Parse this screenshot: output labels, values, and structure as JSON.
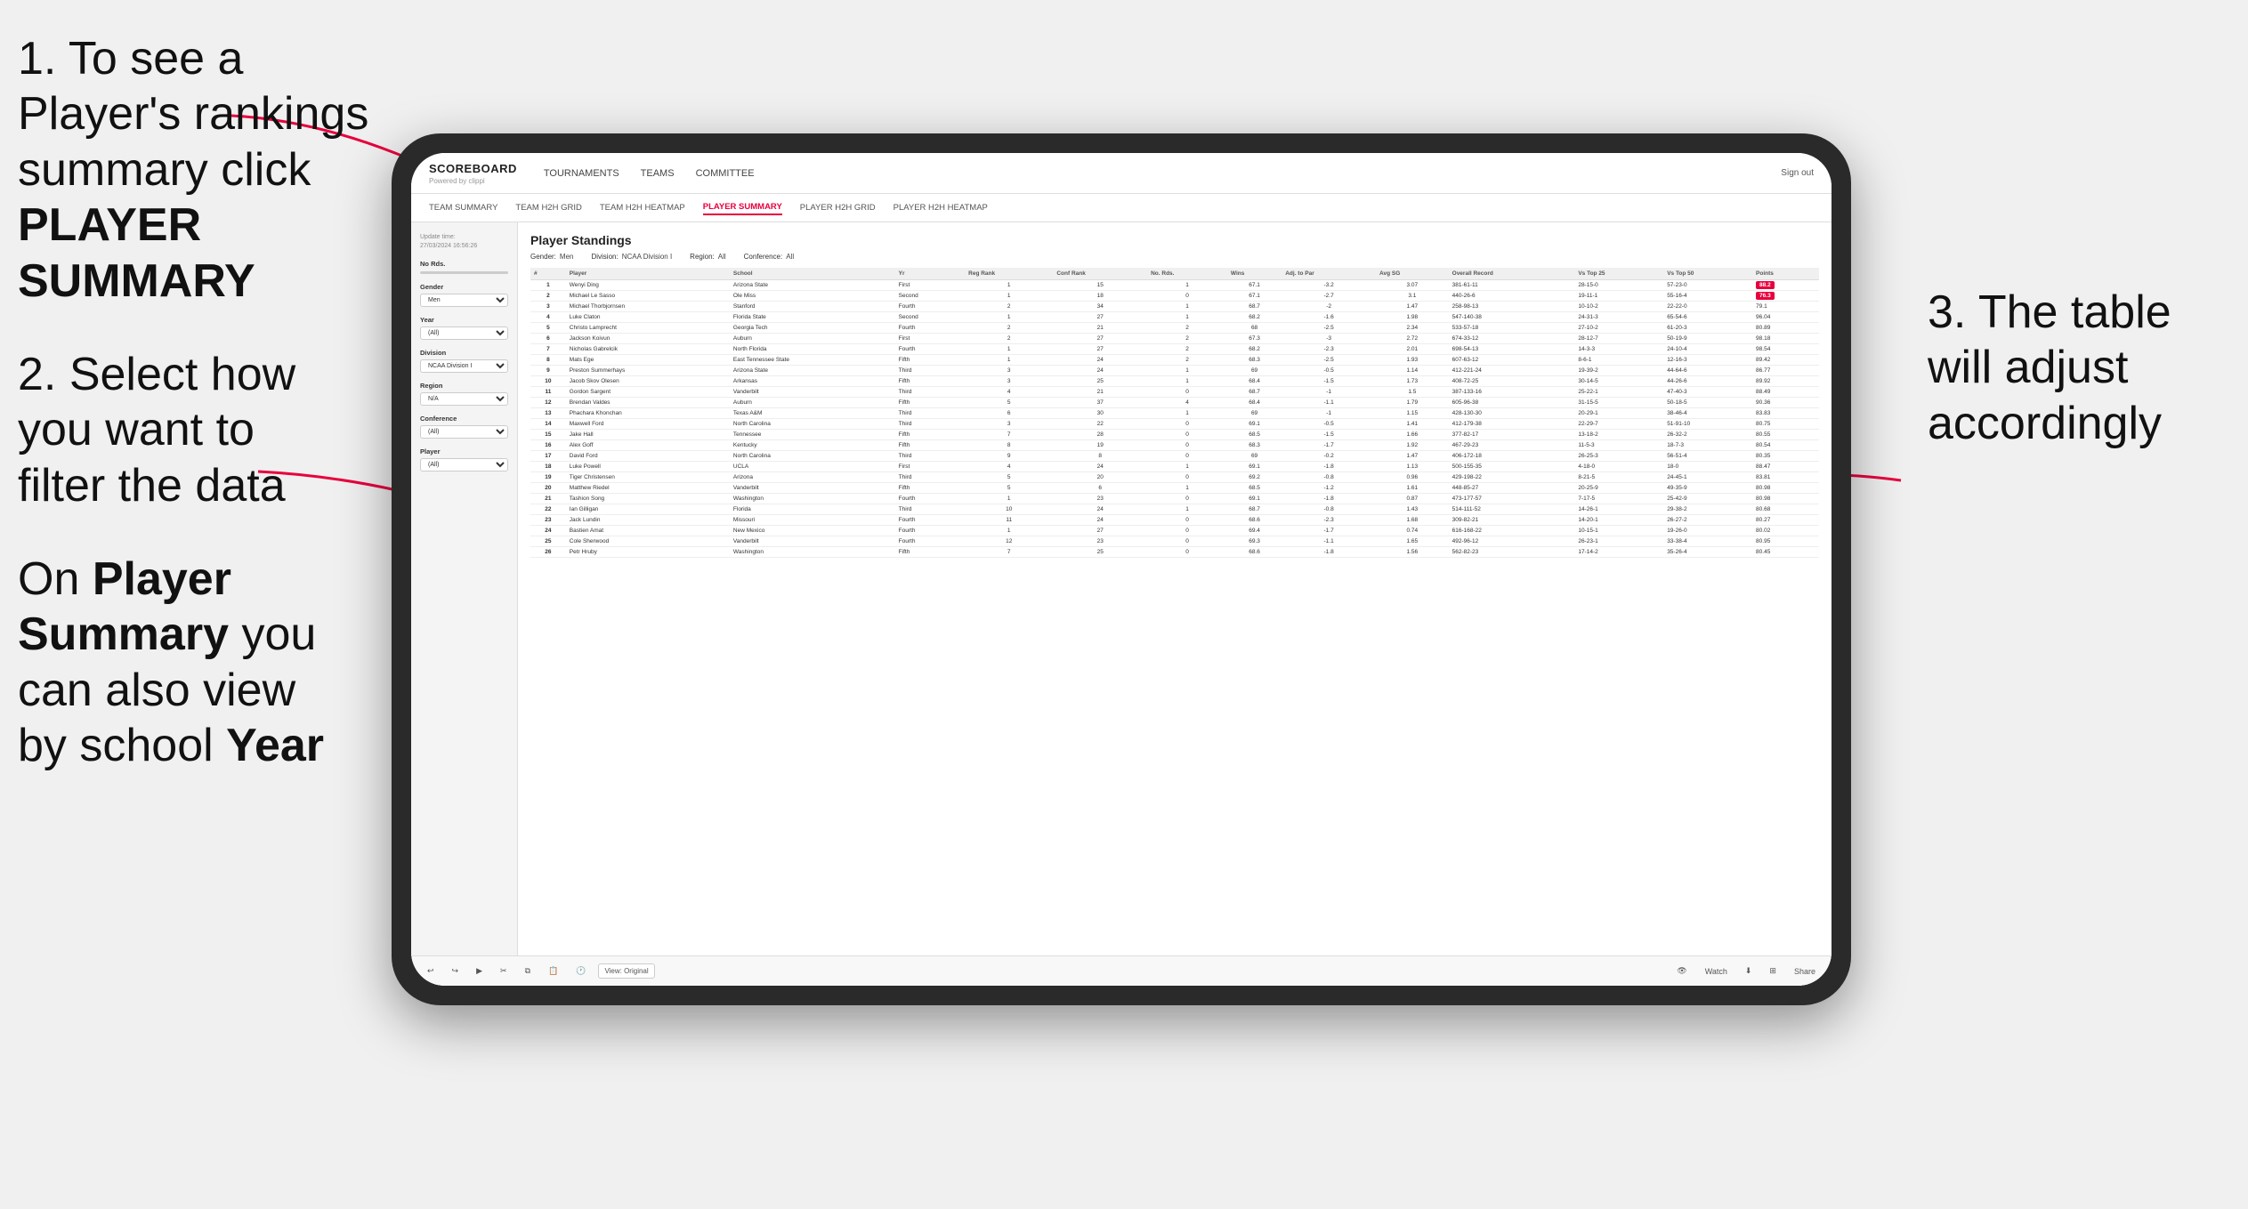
{
  "instructions": {
    "step1_text": "1. To see a Player's rankings summary click ",
    "step1_bold": "PLAYER SUMMARY",
    "step2_text": "2. Select how you want to filter the data",
    "step_bottom_text": "On ",
    "step_bottom_bold1": "Player Summary",
    "step_bottom_rest": " you can also view by school ",
    "step_bottom_bold2": "Year",
    "step3_text": "3. The table will adjust accordingly"
  },
  "app": {
    "logo": "SCOREBOARD",
    "logo_sub": "Powered by clippi",
    "sign_out": "Sign out"
  },
  "nav": {
    "items": [
      {
        "label": "TOURNAMENTS",
        "active": false
      },
      {
        "label": "TEAMS",
        "active": false
      },
      {
        "label": "COMMITTEE",
        "active": false
      }
    ]
  },
  "subnav": {
    "items": [
      {
        "label": "TEAM SUMMARY",
        "active": false
      },
      {
        "label": "TEAM H2H GRID",
        "active": false
      },
      {
        "label": "TEAM H2H HEATMAP",
        "active": false
      },
      {
        "label": "PLAYER SUMMARY",
        "active": true
      },
      {
        "label": "PLAYER H2H GRID",
        "active": false
      },
      {
        "label": "PLAYER H2H HEATMAP",
        "active": false
      }
    ]
  },
  "sidebar": {
    "update_label": "Update time:",
    "update_time": "27/03/2024 16:56:26",
    "no_rds_label": "No Rds.",
    "gender_label": "Gender",
    "gender_value": "Men",
    "year_label": "Year",
    "year_value": "(All)",
    "division_label": "Division",
    "division_value": "NCAA Division I",
    "region_label": "Region",
    "region_value": "N/A",
    "conference_label": "Conference",
    "conference_value": "(All)",
    "player_label": "Player",
    "player_value": "(All)"
  },
  "table": {
    "title": "Player Standings",
    "gender": "Men",
    "division": "NCAA Division I",
    "region": "All",
    "conference": "All",
    "columns": [
      "#",
      "Player",
      "School",
      "Yr",
      "Reg Rank",
      "Conf Rank",
      "No. Rds.",
      "Wins",
      "Adj. to Par",
      "Avg SG",
      "Overall Record",
      "Vs Top 25",
      "Vs Top 50",
      "Points"
    ],
    "rows": [
      {
        "rank": 1,
        "player": "Wenyi Ding",
        "school": "Arizona State",
        "yr": "First",
        "reg_rank": 1,
        "conf_rank": 15,
        "rds": 1,
        "wins": 67.1,
        "adj": -3.2,
        "sg": 3.07,
        "record": "381-61-11",
        "vst25": "28-15-0",
        "vst50": "57-23-0",
        "points": "88.2",
        "highlight": true
      },
      {
        "rank": 2,
        "player": "Michael Le Sasso",
        "school": "Ole Miss",
        "yr": "Second",
        "reg_rank": 1,
        "conf_rank": 18,
        "rds": 0,
        "wins": 67.1,
        "adj": -2.7,
        "sg": 3.1,
        "record": "440-26-6",
        "vst25": "19-11-1",
        "vst50": "55-16-4",
        "points": "76.3",
        "highlight": true
      },
      {
        "rank": 3,
        "player": "Michael Thorbjornsen",
        "school": "Stanford",
        "yr": "Fourth",
        "reg_rank": 2,
        "conf_rank": 34,
        "rds": 1,
        "wins": 68.7,
        "adj": -2.0,
        "sg": 1.47,
        "record": "258-98-13",
        "vst25": "10-10-2",
        "vst50": "22-22-0",
        "points": "79.1"
      },
      {
        "rank": 4,
        "player": "Luke Claton",
        "school": "Florida State",
        "yr": "Second",
        "reg_rank": 1,
        "conf_rank": 27,
        "rds": 1,
        "wins": 68.2,
        "adj": -1.6,
        "sg": 1.98,
        "record": "547-140-38",
        "vst25": "24-31-3",
        "vst50": "65-54-6",
        "points": "96.04"
      },
      {
        "rank": 5,
        "player": "Christo Lamprecht",
        "school": "Georgia Tech",
        "yr": "Fourth",
        "reg_rank": 2,
        "conf_rank": 21,
        "rds": 2,
        "wins": 68.0,
        "adj": -2.5,
        "sg": 2.34,
        "record": "533-57-18",
        "vst25": "27-10-2",
        "vst50": "61-20-3",
        "points": "80.89"
      },
      {
        "rank": 6,
        "player": "Jackson Koivun",
        "school": "Auburn",
        "yr": "First",
        "reg_rank": 2,
        "conf_rank": 27,
        "rds": 2,
        "wins": 67.3,
        "adj": -3.0,
        "sg": 2.72,
        "record": "674-33-12",
        "vst25": "28-12-7",
        "vst50": "50-19-9",
        "points": "98.18"
      },
      {
        "rank": 7,
        "player": "Nicholas Gabrelcik",
        "school": "North Florida",
        "yr": "Fourth",
        "reg_rank": 1,
        "conf_rank": 27,
        "rds": 2,
        "wins": 68.2,
        "adj": -2.3,
        "sg": 2.01,
        "record": "698-54-13",
        "vst25": "14-3-3",
        "vst50": "24-10-4",
        "points": "98.54"
      },
      {
        "rank": 8,
        "player": "Mats Ege",
        "school": "East Tennessee State",
        "yr": "Fifth",
        "reg_rank": 1,
        "conf_rank": 24,
        "rds": 2,
        "wins": 68.3,
        "adj": -2.5,
        "sg": 1.93,
        "record": "607-63-12",
        "vst25": "8-6-1",
        "vst50": "12-16-3",
        "points": "89.42"
      },
      {
        "rank": 9,
        "player": "Preston Summerhays",
        "school": "Arizona State",
        "yr": "Third",
        "reg_rank": 3,
        "conf_rank": 24,
        "rds": 1,
        "wins": 69.0,
        "adj": -0.5,
        "sg": 1.14,
        "record": "412-221-24",
        "vst25": "19-39-2",
        "vst50": "44-64-6",
        "points": "86.77"
      },
      {
        "rank": 10,
        "player": "Jacob Skov Olesen",
        "school": "Arkansas",
        "yr": "Fifth",
        "reg_rank": 3,
        "conf_rank": 25,
        "rds": 1,
        "wins": 68.4,
        "adj": -1.5,
        "sg": 1.73,
        "record": "408-72-25",
        "vst25": "30-14-5",
        "vst50": "44-26-6",
        "points": "89.92"
      },
      {
        "rank": 11,
        "player": "Gordon Sargent",
        "school": "Vanderbilt",
        "yr": "Third",
        "reg_rank": 4,
        "conf_rank": 21,
        "rds": 0,
        "wins": 68.7,
        "adj": -1.0,
        "sg": 1.5,
        "record": "387-133-16",
        "vst25": "25-22-1",
        "vst50": "47-40-3",
        "points": "88.49"
      },
      {
        "rank": 12,
        "player": "Brendan Valdes",
        "school": "Auburn",
        "yr": "Fifth",
        "reg_rank": 5,
        "conf_rank": 37,
        "rds": 4,
        "wins": 68.4,
        "adj": -1.1,
        "sg": 1.79,
        "record": "605-96-38",
        "vst25": "31-15-5",
        "vst50": "50-18-5",
        "points": "90.36"
      },
      {
        "rank": 13,
        "player": "Phachara Khonchan",
        "school": "Texas A&M",
        "yr": "Third",
        "reg_rank": 6,
        "conf_rank": 30,
        "rds": 1,
        "wins": 69.0,
        "adj": -1.0,
        "sg": 1.15,
        "record": "428-130-30",
        "vst25": "20-29-1",
        "vst50": "38-46-4",
        "points": "83.83"
      },
      {
        "rank": 14,
        "player": "Maxwell Ford",
        "school": "North Carolina",
        "yr": "Third",
        "reg_rank": 3,
        "conf_rank": 22,
        "rds": 0,
        "wins": 69.1,
        "adj": -0.5,
        "sg": 1.41,
        "record": "412-179-38",
        "vst25": "22-29-7",
        "vst50": "51-91-10",
        "points": "80.75"
      },
      {
        "rank": 15,
        "player": "Jake Hall",
        "school": "Tennessee",
        "yr": "Fifth",
        "reg_rank": 7,
        "conf_rank": 28,
        "rds": 0,
        "wins": 68.5,
        "adj": -1.5,
        "sg": 1.66,
        "record": "377-82-17",
        "vst25": "13-18-2",
        "vst50": "26-32-2",
        "points": "80.55"
      },
      {
        "rank": 16,
        "player": "Alex Goff",
        "school": "Kentucky",
        "yr": "Fifth",
        "reg_rank": 8,
        "conf_rank": 19,
        "rds": 0,
        "wins": 68.3,
        "adj": -1.7,
        "sg": 1.92,
        "record": "467-29-23",
        "vst25": "11-5-3",
        "vst50": "18-7-3",
        "points": "80.54"
      },
      {
        "rank": 17,
        "player": "David Ford",
        "school": "North Carolina",
        "yr": "Third",
        "reg_rank": 9,
        "conf_rank": 8,
        "rds": 0,
        "wins": 69.0,
        "adj": -0.2,
        "sg": 1.47,
        "record": "406-172-18",
        "vst25": "26-25-3",
        "vst50": "56-51-4",
        "points": "80.35"
      },
      {
        "rank": 18,
        "player": "Luke Powell",
        "school": "UCLA",
        "yr": "First",
        "reg_rank": 4,
        "conf_rank": 24,
        "rds": 1,
        "wins": 69.1,
        "adj": -1.8,
        "sg": 1.13,
        "record": "500-155-35",
        "vst25": "4-18-0",
        "vst50": "18-0",
        "points": "88.47"
      },
      {
        "rank": 19,
        "player": "Tiger Christensen",
        "school": "Arizona",
        "yr": "Third",
        "reg_rank": 5,
        "conf_rank": 20,
        "rds": 0,
        "wins": 69.2,
        "adj": -0.8,
        "sg": 0.96,
        "record": "429-198-22",
        "vst25": "8-21-5",
        "vst50": "24-45-1",
        "points": "83.81"
      },
      {
        "rank": 20,
        "player": "Matthew Riedel",
        "school": "Vanderbilt",
        "yr": "Fifth",
        "reg_rank": 5,
        "conf_rank": 6,
        "rds": 1,
        "wins": 68.5,
        "adj": -1.2,
        "sg": 1.61,
        "record": "448-85-27",
        "vst25": "20-25-9",
        "vst50": "49-35-9",
        "points": "80.98"
      },
      {
        "rank": 21,
        "player": "Tashion Song",
        "school": "Washington",
        "yr": "Fourth",
        "reg_rank": 1,
        "conf_rank": 23,
        "rds": 0,
        "wins": 69.1,
        "adj": -1.8,
        "sg": 0.87,
        "record": "473-177-57",
        "vst25": "7-17-5",
        "vst50": "25-42-9",
        "points": "80.98"
      },
      {
        "rank": 22,
        "player": "Ian Gilligan",
        "school": "Florida",
        "yr": "Third",
        "reg_rank": 10,
        "conf_rank": 24,
        "rds": 1,
        "wins": 68.7,
        "adj": -0.8,
        "sg": 1.43,
        "record": "514-111-52",
        "vst25": "14-26-1",
        "vst50": "29-38-2",
        "points": "80.68"
      },
      {
        "rank": 23,
        "player": "Jack Lundin",
        "school": "Missouri",
        "yr": "Fourth",
        "reg_rank": 11,
        "conf_rank": 24,
        "rds": 0,
        "wins": 68.6,
        "adj": -2.3,
        "sg": 1.68,
        "record": "309-82-21",
        "vst25": "14-20-1",
        "vst50": "26-27-2",
        "points": "80.27"
      },
      {
        "rank": 24,
        "player": "Bastien Amat",
        "school": "New Mexico",
        "yr": "Fourth",
        "reg_rank": 1,
        "conf_rank": 27,
        "rds": 0,
        "wins": 69.4,
        "adj": -1.7,
        "sg": 0.74,
        "record": "616-168-22",
        "vst25": "10-15-1",
        "vst50": "19-26-0",
        "points": "80.02"
      },
      {
        "rank": 25,
        "player": "Cole Sherwood",
        "school": "Vanderbilt",
        "yr": "Fourth",
        "reg_rank": 12,
        "conf_rank": 23,
        "rds": 0,
        "wins": 69.3,
        "adj": -1.1,
        "sg": 1.65,
        "record": "492-96-12",
        "vst25": "26-23-1",
        "vst50": "33-38-4",
        "points": "80.95"
      },
      {
        "rank": 26,
        "player": "Petr Hruby",
        "school": "Washington",
        "yr": "Fifth",
        "reg_rank": 7,
        "conf_rank": 25,
        "rds": 0,
        "wins": 68.6,
        "adj": -1.8,
        "sg": 1.56,
        "record": "562-82-23",
        "vst25": "17-14-2",
        "vst50": "35-26-4",
        "points": "80.45"
      }
    ]
  },
  "toolbar": {
    "view_label": "View: Original",
    "watch_label": "Watch",
    "share_label": "Share"
  }
}
